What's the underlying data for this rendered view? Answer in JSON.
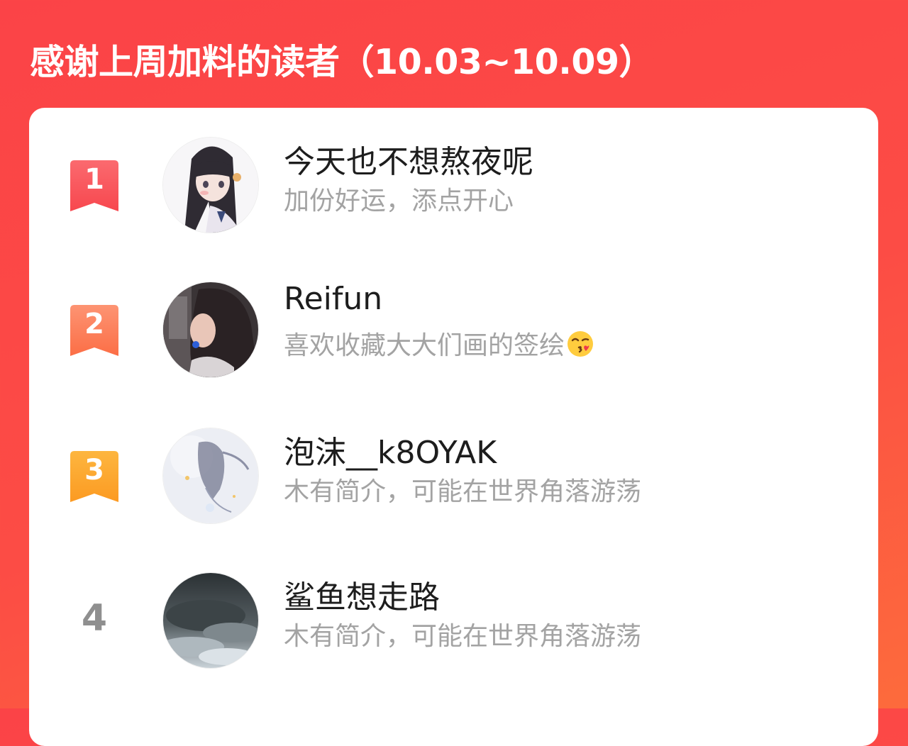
{
  "header": {
    "title": "感谢上周加料的读者（10.03~10.09）"
  },
  "readers": [
    {
      "rank": "1",
      "name": "今天也不想熬夜呢",
      "bio": "加份好运，添点开心"
    },
    {
      "rank": "2",
      "name": "Reifun",
      "bio": "喜欢收藏大大们画的签绘",
      "bio_emoji": "kissing-face-with-heart-emoji"
    },
    {
      "rank": "3",
      "name": "泡沫__k8OYAK",
      "bio": "木有简介，可能在世界角落游荡"
    },
    {
      "rank": "4",
      "name": "鲨鱼想走路",
      "bio": "木有简介，可能在世界角落游荡"
    }
  ],
  "colors": {
    "background": "#fc4c45",
    "rank1": "#f9535a",
    "rank2": "#fd7a52",
    "rank3": "#fda532",
    "rank_plain": "#8f8f8f"
  }
}
